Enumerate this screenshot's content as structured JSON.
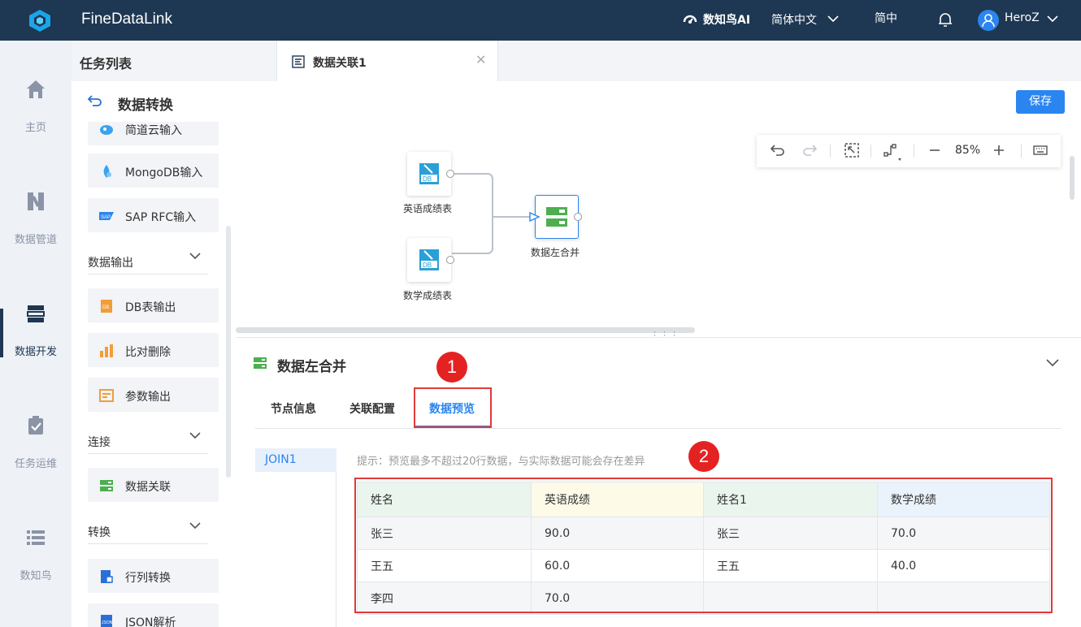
{
  "topbar": {
    "brand": "FineDataLink",
    "ai_label": "数知鸟AI",
    "language": "简体中文",
    "mode": "简中",
    "user": "HeroZ"
  },
  "leftnav": {
    "items": [
      {
        "label": "主页",
        "icon": "home-icon"
      },
      {
        "label": "数据管道",
        "icon": "pipeline-icon"
      },
      {
        "label": "数据开发",
        "icon": "dev-icon"
      },
      {
        "label": "任务运维",
        "icon": "ops-icon"
      },
      {
        "label": "数知鸟",
        "icon": "list-icon"
      }
    ]
  },
  "header": {
    "task_list": "任务列表",
    "tab_label": "数据关联1"
  },
  "titlebar": {
    "title": "数据转换",
    "save": "保存"
  },
  "palette": {
    "items_top": [
      "简道云输入",
      "MongoDB输入",
      "SAP RFC输入"
    ],
    "cat_output": "数据输出",
    "output_items": [
      "DB表输出",
      "比对删除",
      "参数输出"
    ],
    "cat_connect": "连接",
    "connect_items": [
      "数据关联"
    ],
    "cat_transform": "转换",
    "transform_items": [
      "行列转换",
      "JSON解析"
    ]
  },
  "canvas": {
    "zoom": "85%",
    "nodes": {
      "english": "英语成绩表",
      "math": "数学成绩表",
      "merge": "数据左合并"
    }
  },
  "panel": {
    "title": "数据左合并",
    "tabs": [
      "节点信息",
      "关联配置",
      "数据预览"
    ],
    "join": "JOIN1",
    "hint": "提示：预览最多不超过20行数据，与实际数据可能会存在差异",
    "badges": [
      "1",
      "2"
    ],
    "columns": [
      "姓名",
      "英语成绩",
      "姓名1",
      "数学成绩"
    ],
    "rows": [
      [
        "张三",
        "90.0",
        "张三",
        "70.0"
      ],
      [
        "王五",
        "60.0",
        "王五",
        "40.0"
      ],
      [
        "李四",
        "70.0",
        "",
        ""
      ]
    ]
  },
  "colors": {
    "accent": "#2a85f0",
    "topbar": "#1e3752",
    "highlight": "#e03a3a",
    "node_green": "#4caf50",
    "node_blue": "#2a9fd8"
  }
}
